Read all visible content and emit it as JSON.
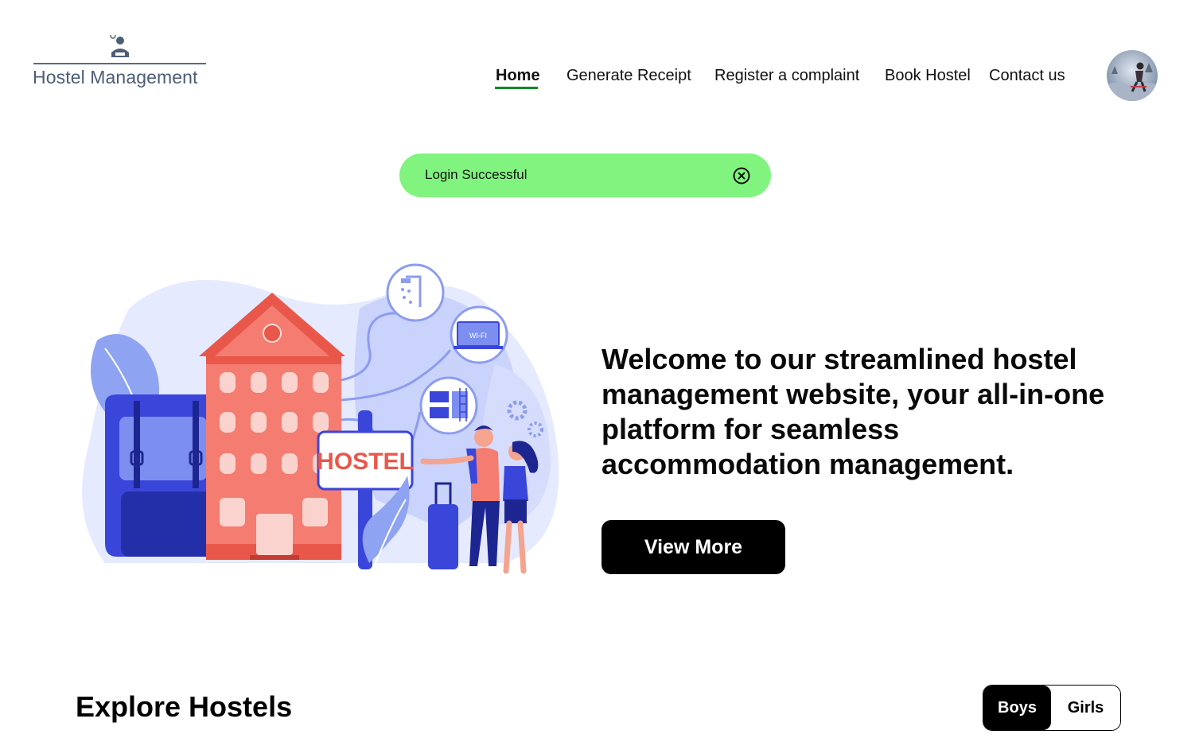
{
  "header": {
    "logo_text": "Hostel Management",
    "nav": [
      {
        "label": "Home",
        "active": true
      },
      {
        "label": "Generate Receipt",
        "active": false
      },
      {
        "label": "Register a complaint",
        "active": false
      },
      {
        "label": "Book Hostel",
        "active": false
      },
      {
        "label": "Contact us",
        "active": false
      }
    ],
    "avatar_icon": "user-avatar-photo"
  },
  "toast": {
    "message": "Login Successful",
    "close_icon": "close-circle-icon",
    "color": "#80f47f"
  },
  "hero": {
    "illustration": {
      "sign_text": "HOSTEL",
      "wifi_label": "WI-FI"
    },
    "title": "Welcome to our streamlined hostel management website, your all-in-one platform for seamless accommodation management.",
    "cta_label": "View More"
  },
  "explore": {
    "title": "Explore Hostels",
    "filters": [
      {
        "label": "Boys",
        "selected": true
      },
      {
        "label": "Girls",
        "selected": false
      }
    ]
  },
  "colors": {
    "nav_active_underline": "#0c8a2a",
    "primary_button": "#000000",
    "logo_text": "#4c5d76"
  }
}
